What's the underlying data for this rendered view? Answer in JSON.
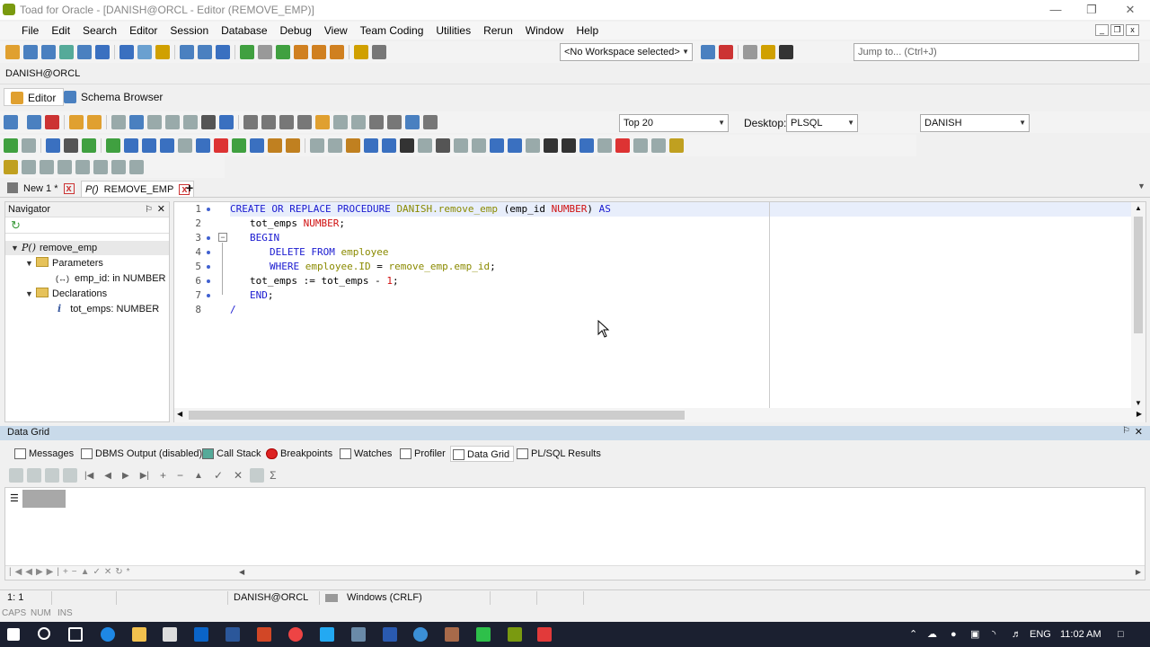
{
  "window": {
    "title": "Toad for Oracle - [DANISH@ORCL - Editor (REMOVE_EMP)]"
  },
  "menu": [
    "File",
    "Edit",
    "Search",
    "Editor",
    "Session",
    "Database",
    "Debug",
    "View",
    "Team Coding",
    "Utilities",
    "Rerun",
    "Window",
    "Help"
  ],
  "toolbar": {
    "workspace": "<No Workspace selected>",
    "jump_placeholder": "Jump to... (Ctrl+J)",
    "top_n": "Top 20",
    "desktop_label": "Desktop:",
    "desktop_value": "PLSQL",
    "schema": "DANISH"
  },
  "connection_tab": "DANISH@ORCL",
  "editor_tabs": {
    "editor": "Editor",
    "schema_browser": "Schema Browser"
  },
  "doc_tabs": [
    {
      "label": "New 1 *"
    },
    {
      "label": "REMOVE_EMP"
    }
  ],
  "navigator": {
    "title": "Navigator",
    "root": "remove_emp",
    "parameters": "Parameters",
    "param1": "emp_id: in NUMBER",
    "declarations": "Declarations",
    "decl1": "tot_emps: NUMBER"
  },
  "code": {
    "line_numbers": [
      "1",
      "2",
      "3",
      "4",
      "5",
      "6",
      "7",
      "8"
    ],
    "l1": {
      "kw1": "CREATE OR REPLACE PROCEDURE",
      "obj": "DANISH.remove_emp",
      "p1": " (emp_id ",
      "ty": "NUMBER",
      "p2": ") ",
      "kw2": "AS"
    },
    "l2": {
      "id": "tot_emps ",
      "ty": "NUMBER",
      "p": ";"
    },
    "l3": {
      "kw": "BEGIN"
    },
    "l4": {
      "kw": "DELETE FROM ",
      "obj": "employee"
    },
    "l5": {
      "kw": "WHERE ",
      "obj1": "employee.ID",
      "op": " = ",
      "obj2": "remove_emp.emp_id",
      "p": ";"
    },
    "l6": {
      "t": "tot_emps := tot_emps - ",
      "num": "1",
      "p": ";"
    },
    "l7": {
      "kw": "END",
      "p": ";"
    },
    "l8": {
      "t": "/"
    }
  },
  "bottom_panel": {
    "title": "Data Grid",
    "tabs": [
      "Messages",
      "DBMS Output (disabled)",
      "Call Stack",
      "Breakpoints",
      "Watches",
      "Profiler",
      "Data Grid",
      "PL/SQL Results"
    ]
  },
  "status": {
    "position": "1:   1",
    "connection": "DANISH@ORCL",
    "line_ending": "Windows (CRLF)",
    "caps": "CAPS",
    "num": "NUM",
    "ins": "INS"
  },
  "taskbar": {
    "lang": "ENG",
    "time": "11:02 AM"
  }
}
